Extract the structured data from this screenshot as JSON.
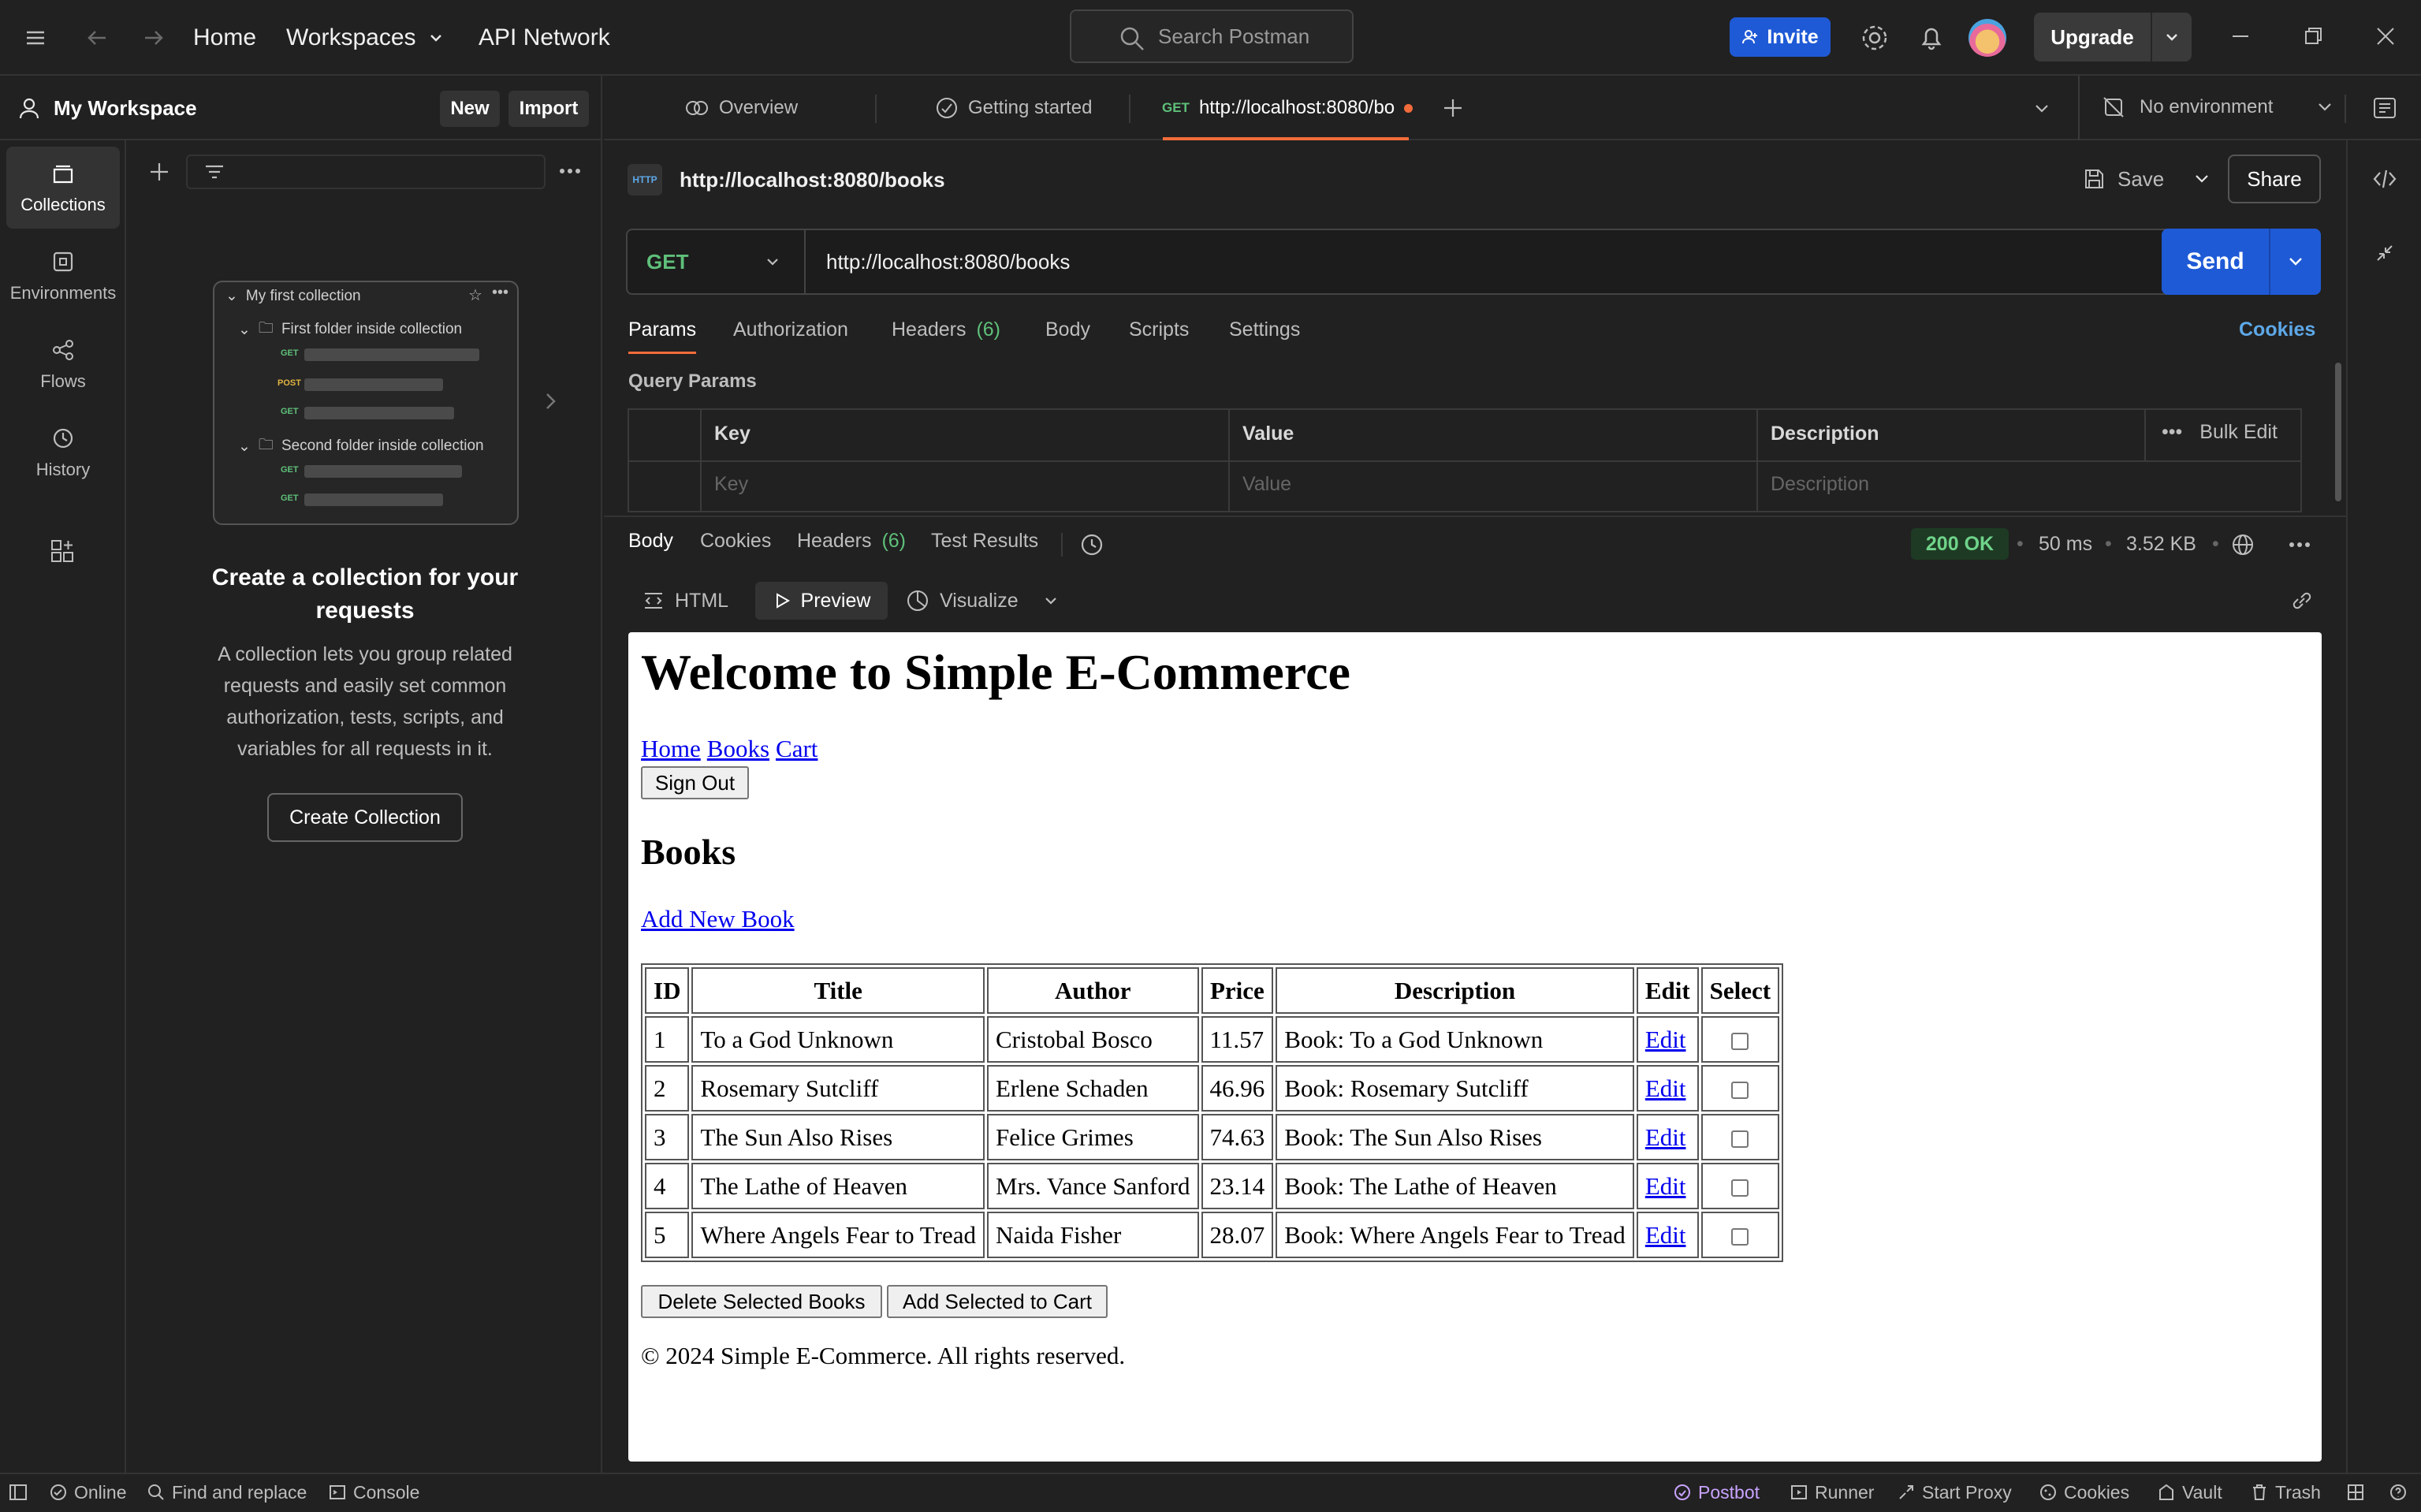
{
  "titlebar": {
    "home": "Home",
    "workspaces": "Workspaces",
    "api_network": "API Network",
    "search_placeholder": "Search Postman",
    "invite": "Invite",
    "upgrade": "Upgrade"
  },
  "workspace": {
    "name": "My Workspace",
    "new_label": "New",
    "import_label": "Import"
  },
  "rail": {
    "items": [
      {
        "label": "Collections",
        "icon": "collections-icon",
        "active": true
      },
      {
        "label": "Environments",
        "icon": "environments-icon"
      },
      {
        "label": "Flows",
        "icon": "flows-icon"
      },
      {
        "label": "History",
        "icon": "history-icon"
      }
    ]
  },
  "sidebar": {
    "illustration": {
      "collection": "My first collection",
      "folder1": "First folder inside collection",
      "folder2": "Second folder inside collection",
      "verbs": [
        "GET",
        "POST",
        "GET",
        "GET",
        "GET"
      ]
    },
    "create_title": "Create a collection for your requests",
    "create_desc": "A collection lets you group related requests and easily set common authorization, tests, scripts, and variables for all requests in it.",
    "create_button": "Create Collection"
  },
  "tabs": {
    "overview": "Overview",
    "getting_started": "Getting started",
    "active_method": "GET",
    "active_url": "http://localhost:8080/bo",
    "environment": "No environment"
  },
  "request": {
    "title": "http://localhost:8080/books",
    "save": "Save",
    "share": "Share",
    "method": "GET",
    "url": "http://localhost:8080/books",
    "send": "Send",
    "tabs": [
      "Params",
      "Authorization",
      "Headers",
      "Body",
      "Scripts",
      "Settings"
    ],
    "headers_count": "(6)",
    "cookies": "Cookies",
    "query_params_label": "Query Params",
    "params_columns": [
      "Key",
      "Value",
      "Description"
    ],
    "bulk_edit": "Bulk Edit",
    "params_placeholders": [
      "Key",
      "Value",
      "Description"
    ]
  },
  "response": {
    "tabs": [
      "Body",
      "Cookies",
      "Headers",
      "Test Results"
    ],
    "headers_count": "(6)",
    "status": "200 OK",
    "time": "50 ms",
    "size": "3.52 KB",
    "views": [
      "HTML",
      "Preview",
      "Visualize"
    ]
  },
  "preview": {
    "heading": "Welcome to Simple E-Commerce",
    "nav": [
      "Home",
      "Books",
      "Cart"
    ],
    "sign_out": "Sign Out",
    "books_heading": "Books",
    "add_new": "Add New Book",
    "columns": [
      "ID",
      "Title",
      "Author",
      "Price",
      "Description",
      "Edit",
      "Select"
    ],
    "rows": [
      {
        "id": "1",
        "title": "To a God Unknown",
        "author": "Cristobal Bosco",
        "price": "11.57",
        "desc": "Book: To a God Unknown",
        "edit": "Edit"
      },
      {
        "id": "2",
        "title": "Rosemary Sutcliff",
        "author": "Erlene Schaden",
        "price": "46.96",
        "desc": "Book: Rosemary Sutcliff",
        "edit": "Edit"
      },
      {
        "id": "3",
        "title": "The Sun Also Rises",
        "author": "Felice Grimes",
        "price": "74.63",
        "desc": "Book: The Sun Also Rises",
        "edit": "Edit"
      },
      {
        "id": "4",
        "title": "The Lathe of Heaven",
        "author": "Mrs. Vance Sanford",
        "price": "23.14",
        "desc": "Book: The Lathe of Heaven",
        "edit": "Edit"
      },
      {
        "id": "5",
        "title": "Where Angels Fear to Tread",
        "author": "Naida Fisher",
        "price": "28.07",
        "desc": "Book: Where Angels Fear to Tread",
        "edit": "Edit"
      }
    ],
    "delete_selected": "Delete Selected Books",
    "add_to_cart": "Add Selected to Cart",
    "footer": "© 2024 Simple E-Commerce. All rights reserved."
  },
  "statusbar": {
    "online": "Online",
    "find_replace": "Find and replace",
    "console": "Console",
    "postbot": "Postbot",
    "runner": "Runner",
    "start_proxy": "Start Proxy",
    "cookies": "Cookies",
    "vault": "Vault",
    "trash": "Trash"
  },
  "colors": {
    "accent_orange": "#f26b3a",
    "primary_blue": "#1f5ad6",
    "get_green": "#5fc07a",
    "post_yellow": "#e0b341",
    "status_ok": "#6fd38a"
  }
}
